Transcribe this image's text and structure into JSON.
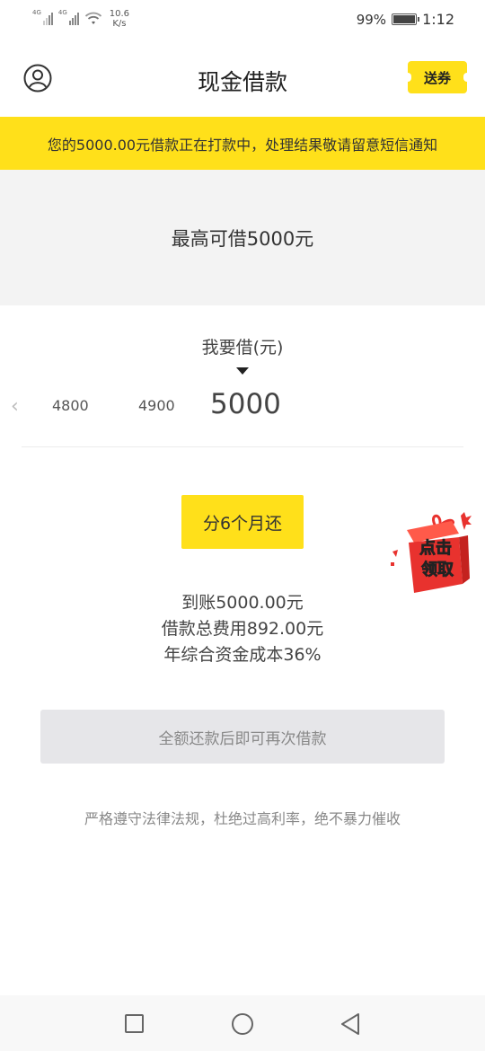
{
  "status_bar": {
    "signal1_label": "4G",
    "signal2_label": "4G",
    "net_speed_value": "10.6",
    "net_speed_unit": "K/s",
    "battery": "99%",
    "battery_level": 0.99,
    "time": "1:12"
  },
  "header": {
    "title": "现金借款",
    "coupon_label": "送券"
  },
  "notice": {
    "text": "您的5000.00元借款正在打款中，处理结果敬请留意短信通知"
  },
  "max_section": {
    "text": "最高可借5000元"
  },
  "picker": {
    "label": "我要借(元)",
    "prev_glyph": "‹",
    "options": [
      "4800",
      "4900"
    ],
    "selected": "5000"
  },
  "term": {
    "label": "分6个月还"
  },
  "promo": {
    "line1": "点击",
    "line2": "领取"
  },
  "summary": {
    "arrival": "到账5000.00元",
    "total_fee": "借款总费用892.00元",
    "annual_cost": "年综合资金成本36%"
  },
  "action": {
    "disabled_label": "全额还款后即可再次借款"
  },
  "footnote": {
    "text": "严格遵守法律法规，杜绝过高利率，绝不暴力催收"
  },
  "colors": {
    "accent_yellow": "#ffe01a",
    "promo_red": "#e8322e"
  }
}
